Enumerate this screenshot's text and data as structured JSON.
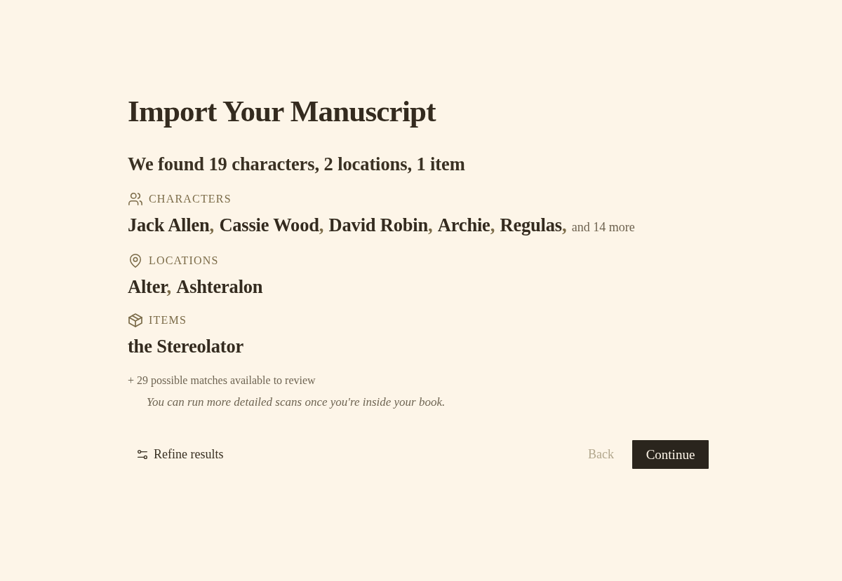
{
  "title": "Import Your Manuscript",
  "summary": "We found 19 characters, 2 locations, 1 item",
  "sections": [
    {
      "kind": "characters",
      "label": "CHARACTERS",
      "separator": ",",
      "names": [
        "Jack Allen",
        "Cassie Wood",
        "David Robin",
        "Archie",
        "Regulas"
      ],
      "more": "and 14 more"
    },
    {
      "kind": "locations",
      "label": "LOCATIONS",
      "separator": ",",
      "names": [
        "Alter",
        "Ashteralon"
      ]
    },
    {
      "kind": "items",
      "label": "ITEMS",
      "names": [
        "the Stereolator"
      ]
    }
  ],
  "possible_matches": "+ 29 possible matches available to review",
  "note": "You can run more detailed scans once you're inside your book.",
  "actions": {
    "refine": "Refine results",
    "back": "Back",
    "continue": "Continue"
  }
}
